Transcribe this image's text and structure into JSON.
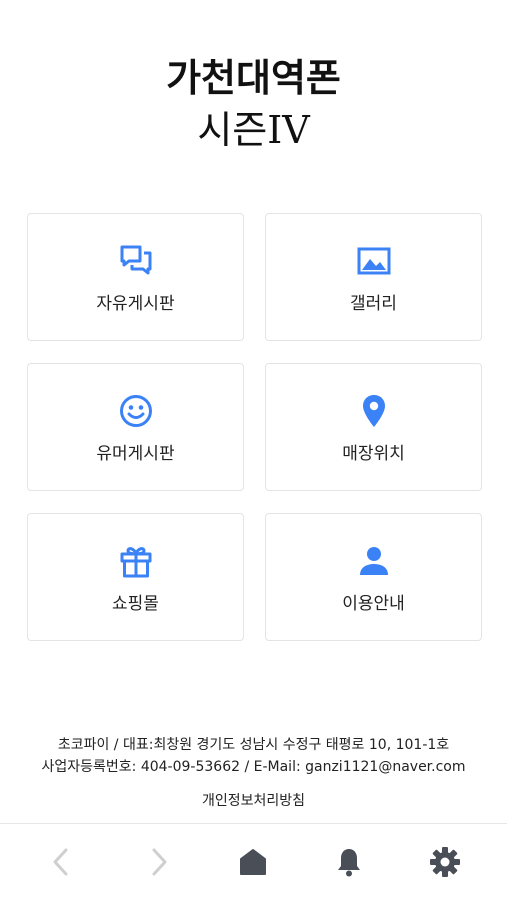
{
  "header": {
    "title_line1": "가천대역폰",
    "title_line2": "시즌IV"
  },
  "menu": [
    {
      "label": "자유게시판",
      "icon": "chat-bubbles-icon"
    },
    {
      "label": "갤러리",
      "icon": "image-icon"
    },
    {
      "label": "유머게시판",
      "icon": "smiley-icon"
    },
    {
      "label": "매장위치",
      "icon": "location-pin-icon"
    },
    {
      "label": "쇼핑몰",
      "icon": "gift-icon"
    },
    {
      "label": "이용안내",
      "icon": "person-icon"
    }
  ],
  "footer": {
    "company_line": "초코파이 / 대표:최창원 경기도 성남시 수정구 태평로 10, 101-1호",
    "registration_line": "사업자등록번호: 404-09-53662 / E-Mail: ganzi1121@naver.com",
    "privacy_policy": "개인정보처리방침"
  },
  "bottom_nav": [
    "back-icon",
    "forward-icon",
    "home-icon",
    "bell-icon",
    "gear-icon"
  ],
  "colors": {
    "accent": "#3b82f6",
    "nav_disabled": "#cfcfcf",
    "nav_active": "#4a4f57"
  }
}
